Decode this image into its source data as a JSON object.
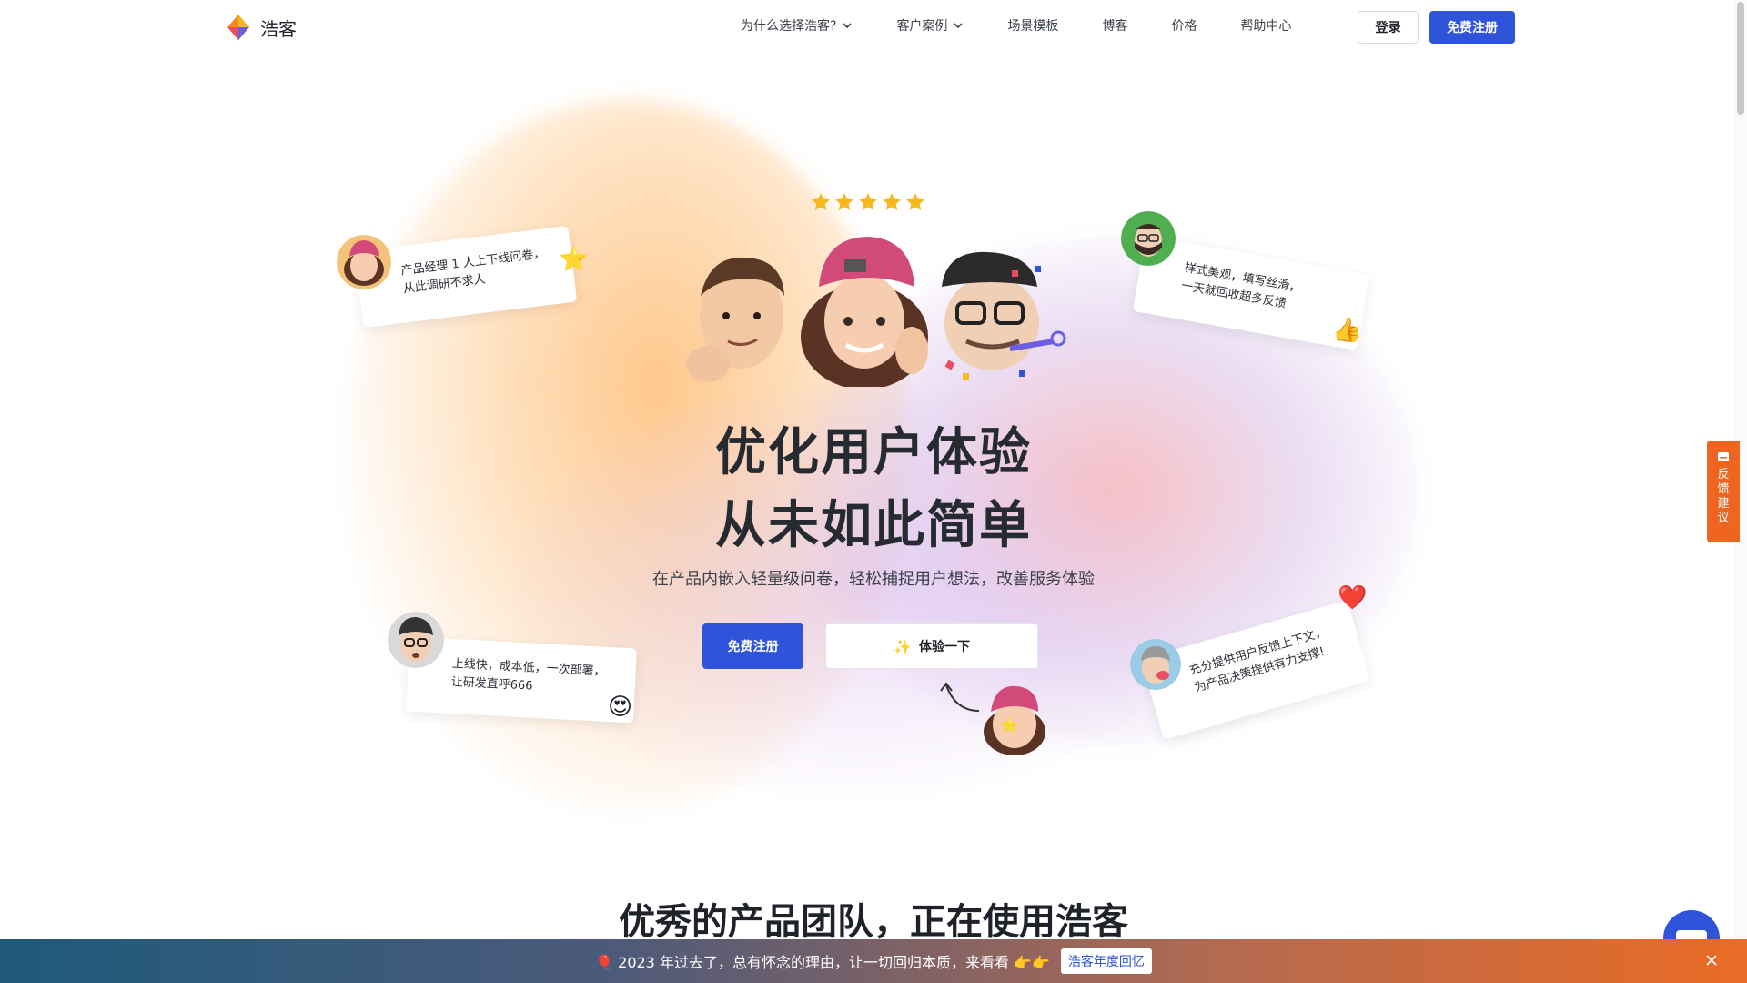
{
  "header": {
    "logo_text": "浩客",
    "nav": [
      {
        "label": "为什么选择浩客?",
        "dropdown": true
      },
      {
        "label": "客户案例",
        "dropdown": true
      },
      {
        "label": "场景模板",
        "dropdown": false
      },
      {
        "label": "博客",
        "dropdown": false
      },
      {
        "label": "价格",
        "dropdown": false
      },
      {
        "label": "帮助中心",
        "dropdown": false
      }
    ],
    "login_label": "登录",
    "signup_label": "免费注册"
  },
  "hero": {
    "rating_stars": 5,
    "title_line1": "优化用户体验",
    "title_line2": "从未如此简单",
    "subtitle": "在产品内嵌入轻量级问卷，轻松捕捉用户想法，改善服务体验",
    "signup_label": "免费注册",
    "try_label": "体验一下",
    "try_icon": "sparkles-icon"
  },
  "testimonials": [
    {
      "line1": "产品经理 1 人上下线问卷，",
      "line2": "从此调研不求人",
      "emoji": "⭐"
    },
    {
      "line1": "样式美观，填写丝滑，",
      "line2": "一天就回收超多反馈",
      "emoji": "👍"
    },
    {
      "line1": "上线快，成本低，一次部署，",
      "line2": "让研发直呼666",
      "emoji": "😍"
    },
    {
      "line1": "充分提供用户反馈上下文，",
      "line2": "为产品决策提供有力支撑!",
      "emoji": "❤️"
    }
  ],
  "section_title": "优秀的产品团队，正在使用浩客",
  "feedback_tab": {
    "label_chars": [
      "反",
      "馈",
      "建",
      "议"
    ]
  },
  "banner": {
    "text": "🎈 2023 年过去了，总有怀念的理由，让一切回归本质，来看看 👉👉",
    "button_label": "浩客年度回忆"
  },
  "colors": {
    "primary": "#2f54d9",
    "accent_orange": "#ef6520",
    "star": "#f5b81f"
  }
}
